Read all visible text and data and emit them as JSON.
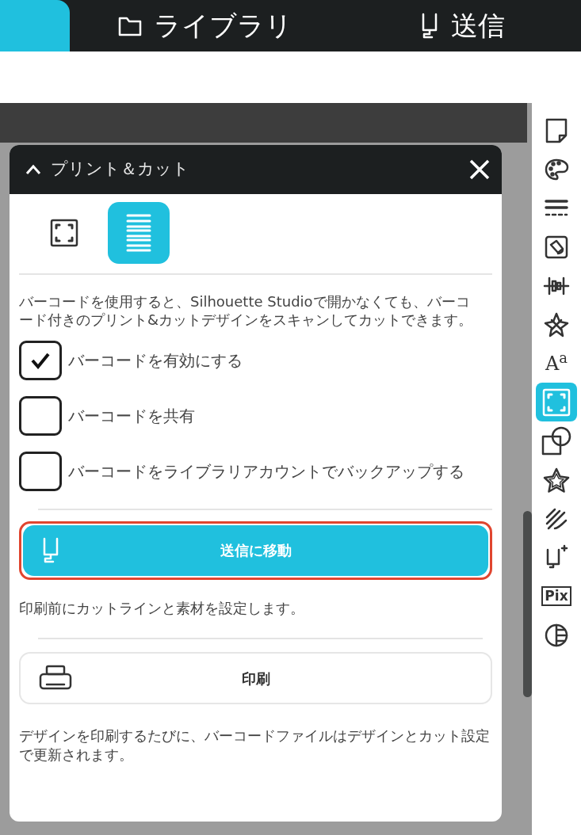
{
  "tabs": [
    {
      "selected": true
    },
    {
      "label": "ライブラリ",
      "kind": "library",
      "selected": false
    },
    {
      "label": "送信",
      "kind": "send",
      "selected": false
    }
  ],
  "panel": {
    "title": "プリント＆カット",
    "expanded": true,
    "modes": [
      {
        "kind": "frame",
        "selected": false
      },
      {
        "kind": "barcode",
        "selected": true
      }
    ],
    "description": "バーコードを使用すると、Silhouette Studioで開かなくても、バーコード付きのプリント&カットデザインをスキャンしてカットできます。",
    "options": [
      {
        "label": "バーコードを有効にする",
        "checked": true
      },
      {
        "label": "バーコードを共有",
        "checked": false
      },
      {
        "label": "バーコードをライブラリアカウントでバックアップする",
        "checked": false
      }
    ],
    "send_button": {
      "label": "送信に移動",
      "highlighted": true
    },
    "send_note": "印刷前にカットラインと素材を設定します。",
    "print_button": {
      "label": "印刷"
    },
    "print_note": "デザインを印刷するたびに、バーコードファイルはデザインとカット設定で更新されます。"
  },
  "toolbar": [
    {
      "kind": "page",
      "selected": false
    },
    {
      "kind": "palette",
      "selected": false
    },
    {
      "kind": "lines",
      "selected": false
    },
    {
      "kind": "fill",
      "selected": false
    },
    {
      "kind": "align",
      "selected": false
    },
    {
      "kind": "burst",
      "selected": false
    },
    {
      "kind": "text",
      "label": "A$^{a}$",
      "selected": false
    },
    {
      "kind": "frame",
      "selected": true
    },
    {
      "kind": "shapes",
      "selected": false
    },
    {
      "kind": "star",
      "selected": false
    },
    {
      "kind": "sketch",
      "selected": false
    },
    {
      "kind": "send-add",
      "selected": false
    },
    {
      "kind": "text",
      "label": "Pix",
      "selected": false
    },
    {
      "kind": "contrast",
      "selected": false
    }
  ]
}
